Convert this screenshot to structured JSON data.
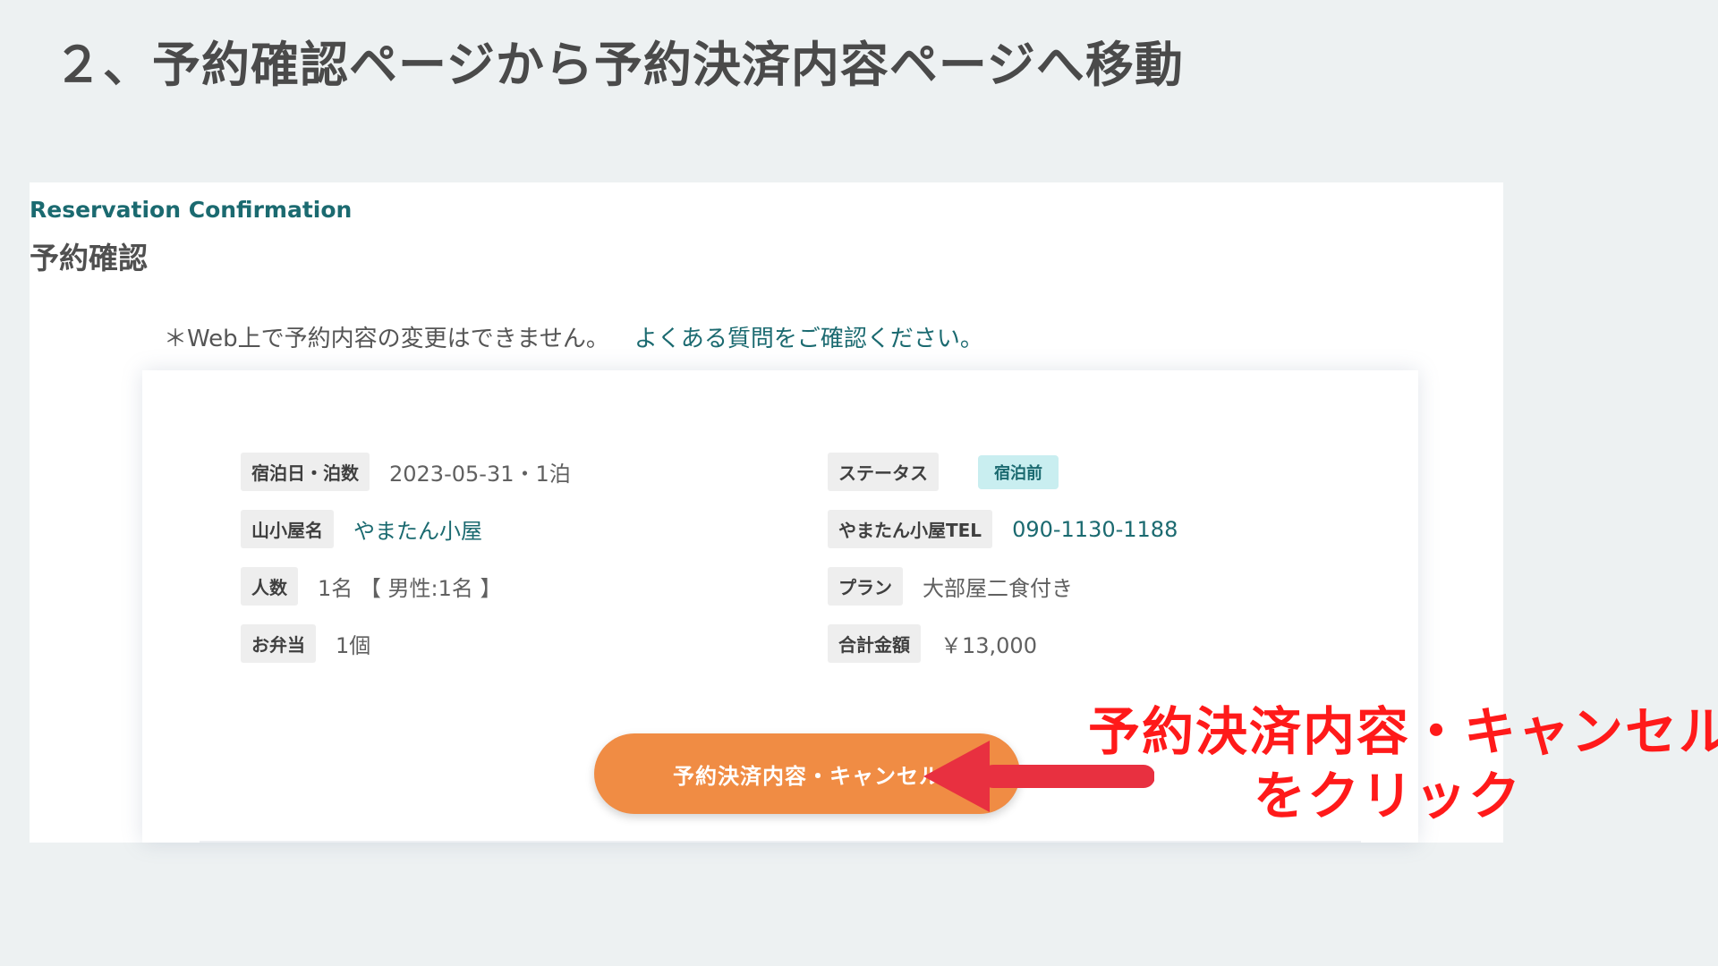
{
  "slide": {
    "title": "２、予約確認ページから予約決済内容ページへ移動"
  },
  "page": {
    "eyebrow": "Reservation Confirmation",
    "heading": "予約確認",
    "notice": "＊Web上で予約内容の変更はできません。",
    "faq_link": "よくある質問をご確認ください。"
  },
  "details": {
    "stay_date": {
      "label": "宿泊日・泊数",
      "value": "2023-05-31・1泊"
    },
    "status": {
      "label": "ステータス",
      "value": "宿泊前"
    },
    "hut_name": {
      "label": "山小屋名",
      "value": "やまたん小屋"
    },
    "hut_tel": {
      "label": "やまたん小屋TEL",
      "value": "090-1130-1188"
    },
    "guests": {
      "label": "人数",
      "value": "1名 【 男性:1名 】"
    },
    "plan": {
      "label": "プラン",
      "value": "大部屋二食付き"
    },
    "bento": {
      "label": "お弁当",
      "value": "1個"
    },
    "total": {
      "label": "合計金額",
      "value": "￥13,000"
    }
  },
  "actions": {
    "payment_cancel_label": "予約決済内容・キャンセル"
  },
  "annotation": {
    "line1": "予約決済内容・キャンセル",
    "line2": "をクリック"
  },
  "colors": {
    "accent_teal": "#1b6a70",
    "button_orange": "#f08c44",
    "annotation_red": "#ff1a1a",
    "arrow_red": "#e83040",
    "badge_bg": "#c9eef0"
  },
  "icons": {
    "arrow": "left-arrow-icon"
  }
}
